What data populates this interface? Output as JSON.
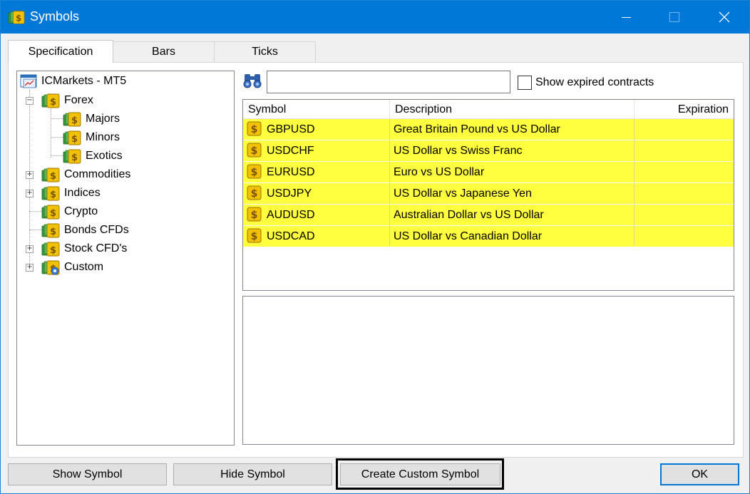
{
  "window": {
    "title": "Symbols",
    "accent": "#0078d7",
    "icon": "symbols-dollar-icon"
  },
  "tabs": [
    {
      "label": "Specification",
      "active": true
    },
    {
      "label": "Bars",
      "active": false
    },
    {
      "label": "Ticks",
      "active": false
    }
  ],
  "tree": {
    "root": "ICMarkets - MT5",
    "forex": "Forex",
    "majors": "Majors",
    "minors": "Minors",
    "exotics": "Exotics",
    "commodities": "Commodities",
    "indices": "Indices",
    "crypto": "Crypto",
    "bonds": "Bonds CFDs",
    "stocks": "Stock CFD's",
    "custom": "Custom"
  },
  "search": {
    "value": "",
    "placeholder": "",
    "icon": "binoculars-icon"
  },
  "filter": {
    "show_expired_label": "Show expired contracts",
    "checked": false
  },
  "table": {
    "headers": {
      "symbol": "Symbol",
      "description": "Description",
      "expiration": "Expiration"
    },
    "highlight_color": "#ffff40",
    "rows": [
      {
        "symbol": "GBPUSD",
        "description": "Great Britain Pound vs US Dollar",
        "expiration": ""
      },
      {
        "symbol": "USDCHF",
        "description": "US Dollar vs Swiss Franc",
        "expiration": ""
      },
      {
        "symbol": "EURUSD",
        "description": "Euro vs US Dollar",
        "expiration": ""
      },
      {
        "symbol": "USDJPY",
        "description": "US Dollar vs Japanese Yen",
        "expiration": ""
      },
      {
        "symbol": "AUDUSD",
        "description": "Australian Dollar vs US Dollar",
        "expiration": ""
      },
      {
        "symbol": "USDCAD",
        "description": "US Dollar vs Canadian Dollar",
        "expiration": ""
      }
    ]
  },
  "buttons": {
    "show_symbol": "Show Symbol",
    "hide_symbol": "Hide Symbol",
    "create_custom_symbol": "Create Custom Symbol",
    "ok": "OK"
  }
}
